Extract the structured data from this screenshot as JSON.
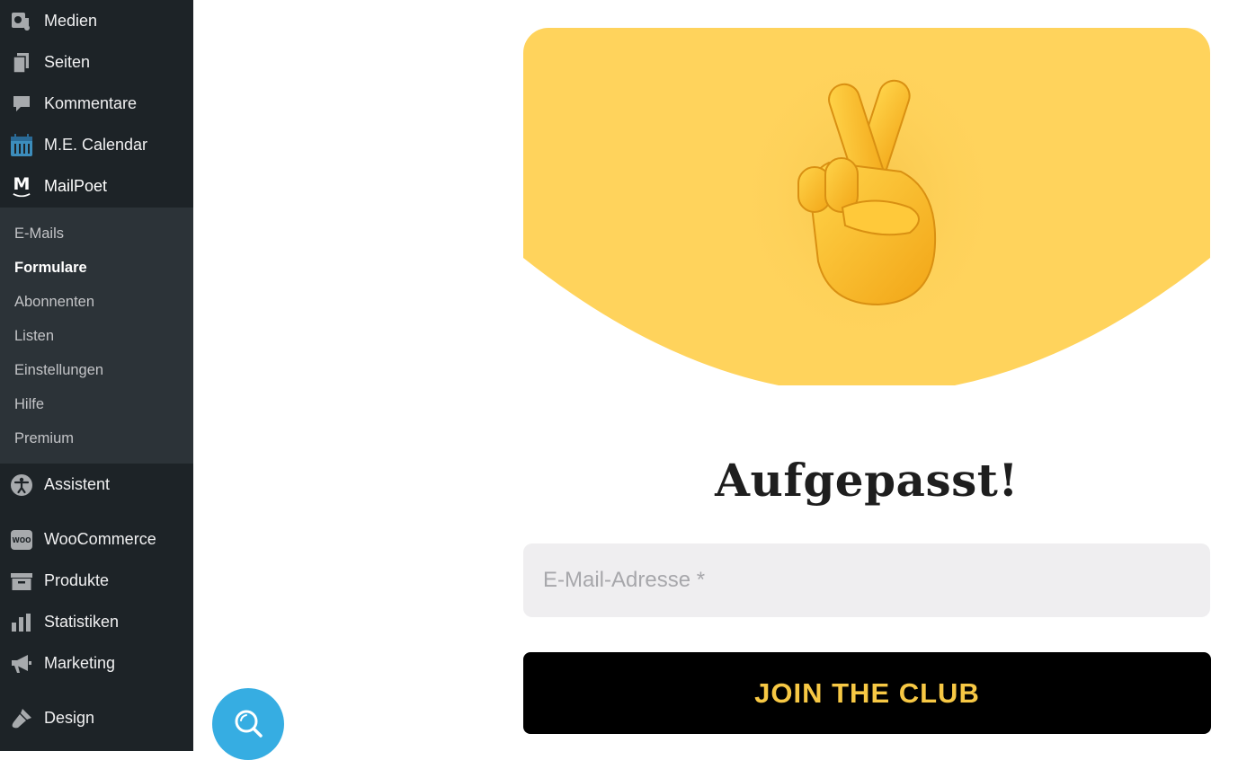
{
  "sidebar": {
    "items_top": [
      {
        "label": "Medien",
        "icon": "media-icon"
      },
      {
        "label": "Seiten",
        "icon": "pages-icon"
      },
      {
        "label": "Kommentare",
        "icon": "comments-icon"
      },
      {
        "label": "M.E. Calendar",
        "icon": "calendar-icon"
      },
      {
        "label": "MailPoet",
        "icon": "mailpoet-icon"
      }
    ],
    "submenu": [
      {
        "label": "E-Mails"
      },
      {
        "label": "Formulare",
        "active": true
      },
      {
        "label": "Abonnenten"
      },
      {
        "label": "Listen"
      },
      {
        "label": "Einstellungen"
      },
      {
        "label": "Hilfe"
      },
      {
        "label": "Premium"
      }
    ],
    "items_bottom": [
      {
        "label": "Assistent",
        "icon": "accessibility-icon"
      },
      {
        "label": "WooCommerce",
        "icon": "woocommerce-icon"
      },
      {
        "label": "Produkte",
        "icon": "archive-icon"
      },
      {
        "label": "Statistiken",
        "icon": "bar-chart-icon"
      },
      {
        "label": "Marketing",
        "icon": "megaphone-icon"
      },
      {
        "label": "Design",
        "icon": "brush-icon"
      }
    ],
    "woo_badge": "WOO",
    "mailpoet_letter": "M"
  },
  "form": {
    "title": "Aufgepasst!",
    "email_placeholder": "E-Mail-Adresse *",
    "submit_label": "JOIN THE CLUB",
    "hero_emoji": "crossed-fingers-icon"
  },
  "colors": {
    "sidebar_bg": "#1d2327",
    "submenu_bg": "#2c3338",
    "hero_yellow": "#ffd35c",
    "button_bg": "#000000",
    "button_text": "#f7c844",
    "input_bg": "#efeef0",
    "fab_blue": "#36ade2"
  }
}
